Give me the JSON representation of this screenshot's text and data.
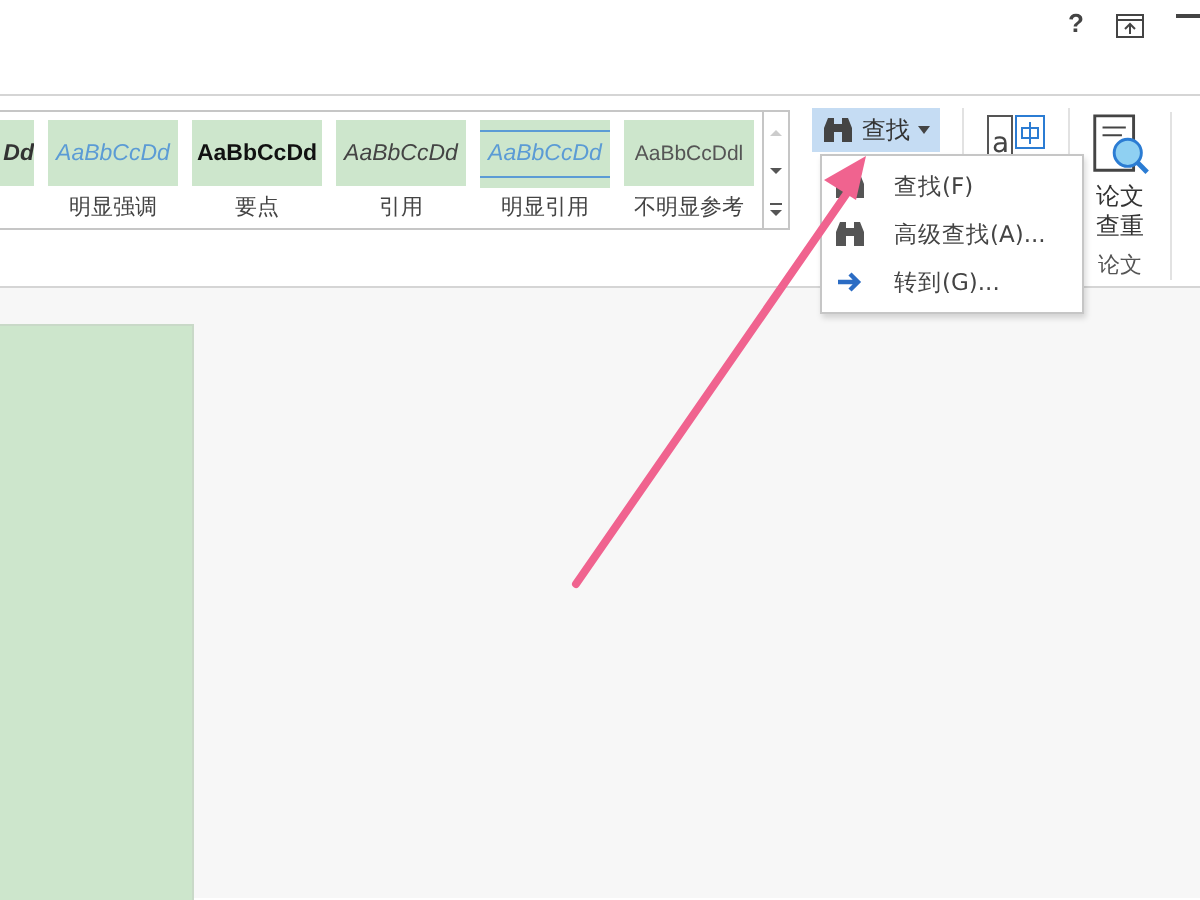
{
  "title_bar": {
    "help": "?"
  },
  "styles_gallery": {
    "items": [
      {
        "sample": "Dd",
        "kind": "cut"
      },
      {
        "sample": "AaBbCcDd",
        "label": "明显强调",
        "kind": "intense-emphasis"
      },
      {
        "sample": "AaBbCcDd",
        "label": "要点",
        "kind": "strong"
      },
      {
        "sample": "AaBbCcDd",
        "label": "引用",
        "kind": "quote"
      },
      {
        "sample": "AaBbCcDd",
        "label": "明显引用",
        "kind": "intense-quote"
      },
      {
        "sample": "AaBbCcDdl",
        "label": "不明显参考",
        "kind": "subtle-reference"
      }
    ]
  },
  "find_button": {
    "label": "查找",
    "selected": true
  },
  "translate_button": {
    "letter": "a"
  },
  "paper_check": {
    "label_line_1": "论文",
    "label_line_2": "查重",
    "group_label": "论文"
  },
  "find_menu": {
    "items": [
      {
        "label": "查找(F)",
        "kind": "find"
      },
      {
        "label": "高级查找(A)...",
        "kind": "find"
      },
      {
        "label": "转到(G)...",
        "kind": "goto"
      }
    ]
  }
}
